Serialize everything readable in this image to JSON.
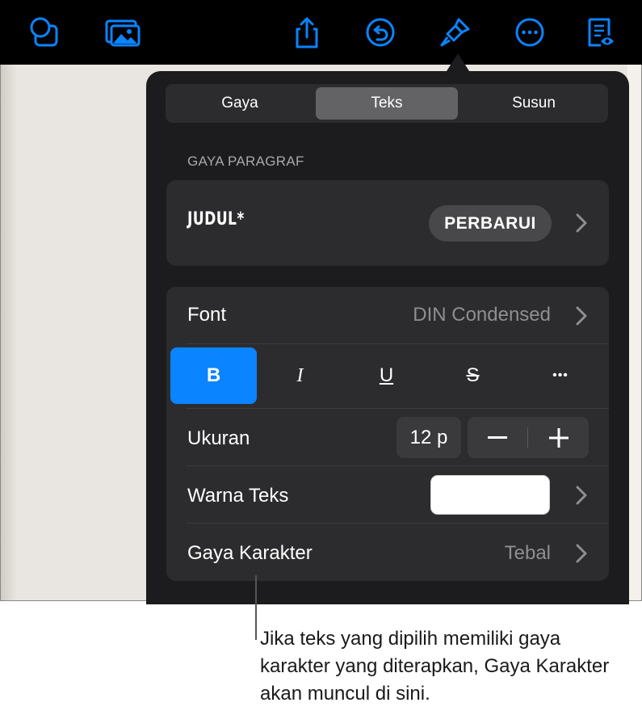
{
  "toolbar": {
    "icons": [
      "shapes-icon",
      "media-icon",
      "share-icon",
      "undo-icon",
      "format-brush-icon",
      "more-icon",
      "reader-view-icon"
    ],
    "accent": "#0a84ff"
  },
  "tabs": [
    {
      "label": "Gaya",
      "active": false
    },
    {
      "label": "Teks",
      "active": true
    },
    {
      "label": "Susun",
      "active": false
    }
  ],
  "paragraph_style": {
    "section_label": "GAYA PARAGRAF",
    "name": "JUDUL*",
    "update_label": "PERBARUI"
  },
  "font": {
    "label": "Font",
    "value": "DIN Condensed"
  },
  "format_buttons": {
    "bold": "B",
    "italic": "I",
    "underline": "U",
    "strikethrough": "S",
    "more": "•••"
  },
  "size": {
    "label": "Ukuran",
    "value": "12 p"
  },
  "text_color": {
    "label": "Warna Teks",
    "swatch_color": "#ffffff"
  },
  "character_style": {
    "label": "Gaya Karakter",
    "value": "Tebal"
  },
  "callout": {
    "text": "Jika teks yang dipilih memiliki gaya karakter yang diterapkan, Gaya Karakter akan muncul di sini."
  }
}
